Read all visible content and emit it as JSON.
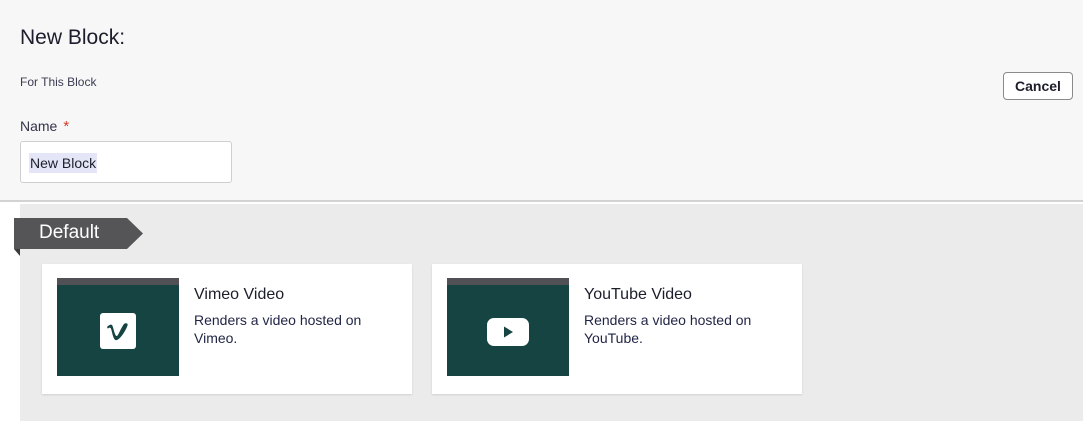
{
  "header": {
    "title": "New Block:",
    "subtitle": "For This Block",
    "cancel_label": "Cancel"
  },
  "form": {
    "name_label": "Name",
    "required_marker": "*",
    "name_value": "New Block"
  },
  "group": {
    "label": "Default"
  },
  "cards": [
    {
      "title": "Vimeo Video",
      "description": "Renders a video hosted on Vimeo.",
      "icon": "vimeo-icon"
    },
    {
      "title": "YouTube Video",
      "description": "Renders a video hosted on YouTube.",
      "icon": "youtube-icon"
    }
  ],
  "colors": {
    "thumbnail_bg": "#164442",
    "tab_bg": "#555558",
    "required": "#d33a2c"
  }
}
